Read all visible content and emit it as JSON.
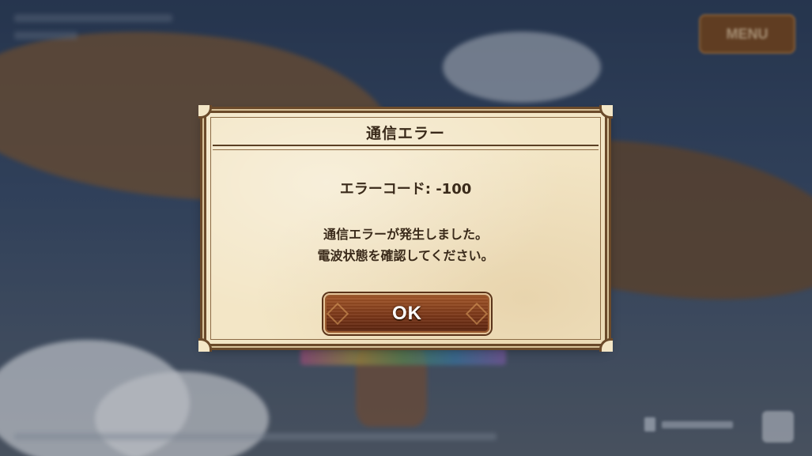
{
  "menu": {
    "label": "MENU"
  },
  "dialog": {
    "title": "通信エラー",
    "error_code": "エラーコード: -100",
    "message_lines": [
      "通信エラーが発生しました。",
      "電波状態を確認してください。"
    ],
    "ok_label": "OK"
  },
  "colors": {
    "panel_bg": "#f3e6c6",
    "panel_border": "#6b4a2a",
    "button_brown": "#7b3718",
    "text_dark": "#3a2a1a"
  }
}
